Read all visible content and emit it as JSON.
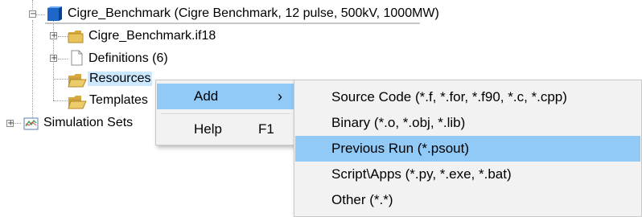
{
  "tree": {
    "root_label": "Cigre_Benchmark (Cigre Benchmark, 12 pulse, 500kV, 1000MW)",
    "items": [
      {
        "label": "Cigre_Benchmark.if18"
      },
      {
        "label": "Definitions (6)"
      },
      {
        "label": "Resources"
      },
      {
        "label": "Templates"
      }
    ],
    "simulation_sets": "Simulation Sets",
    "expand_collapsed": "+",
    "expand_open": "−"
  },
  "context_menu": {
    "items": [
      {
        "label": "Add",
        "arrow": "›"
      },
      {
        "label": "Help",
        "shortcut": "F1"
      }
    ]
  },
  "submenu": {
    "items": [
      {
        "label": "Source Code (*.f, *.for, *.f90, *.c, *.cpp)"
      },
      {
        "label": "Binary (*.o, *.obj, *.lib)"
      },
      {
        "label": "Previous Run (*.psout)",
        "highlighted": true
      },
      {
        "label": "Script\\Apps (*.py, *.exe, *.bat)"
      },
      {
        "label": "Other (*.*)"
      }
    ]
  },
  "colors": {
    "highlight": "#91c9f7",
    "selection": "#cce8ff",
    "menu_bg": "#f2f2f2",
    "folder": "#e8c25a"
  }
}
